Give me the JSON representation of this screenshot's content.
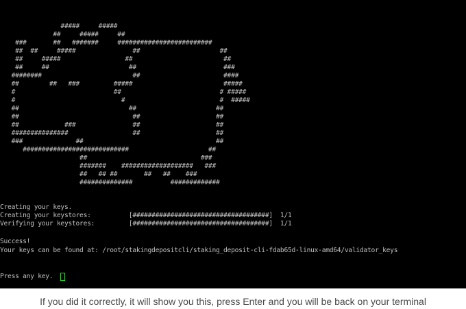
{
  "terminal": {
    "colors": {
      "background": "#000000",
      "text": "#c0c0c0",
      "cursor": "#33d633"
    },
    "art": [
      "                #####     #####",
      "              ##     #####     ##",
      "    ###       ##   #######     #########################",
      "    ##  ##     #####               ##                     ##",
      "    ##     #####                 ##                        ##",
      "    ##     ##                     ##                       ###",
      "   ########                        ##                      ####",
      "   ##        ##   ###         #####                        #####",
      "   #                          ##                          # #####",
      "   #                            #                         #  #####",
      "   ##                             ##                     ##",
      "   ##                              ##                    ##",
      "   ##            ###               ##                    ##",
      "   ###############                 ##                    ##",
      "   ###              ##                                   ##",
      "      ############################                     ##",
      "                     ##                              ###",
      "                     #######    ###################   ###",
      "                     ##   ## ##       ##   ##    ###",
      "                     ##############          #############"
    ],
    "output": [
      "Creating your keys.",
      "Creating your keystores:          [####################################]  1/1",
      "Verifying your keystores:         [####################################]  1/1",
      "",
      "Success!",
      "Your keys can be found at: /root/stakingdepositcli/staking_deposit-cli-fdab65d-linux-amd64/validator_keys",
      "",
      "",
      "Press any key."
    ]
  },
  "caption": "If you did it correctly, it will show you this, press Enter and you will be back on your terminal"
}
